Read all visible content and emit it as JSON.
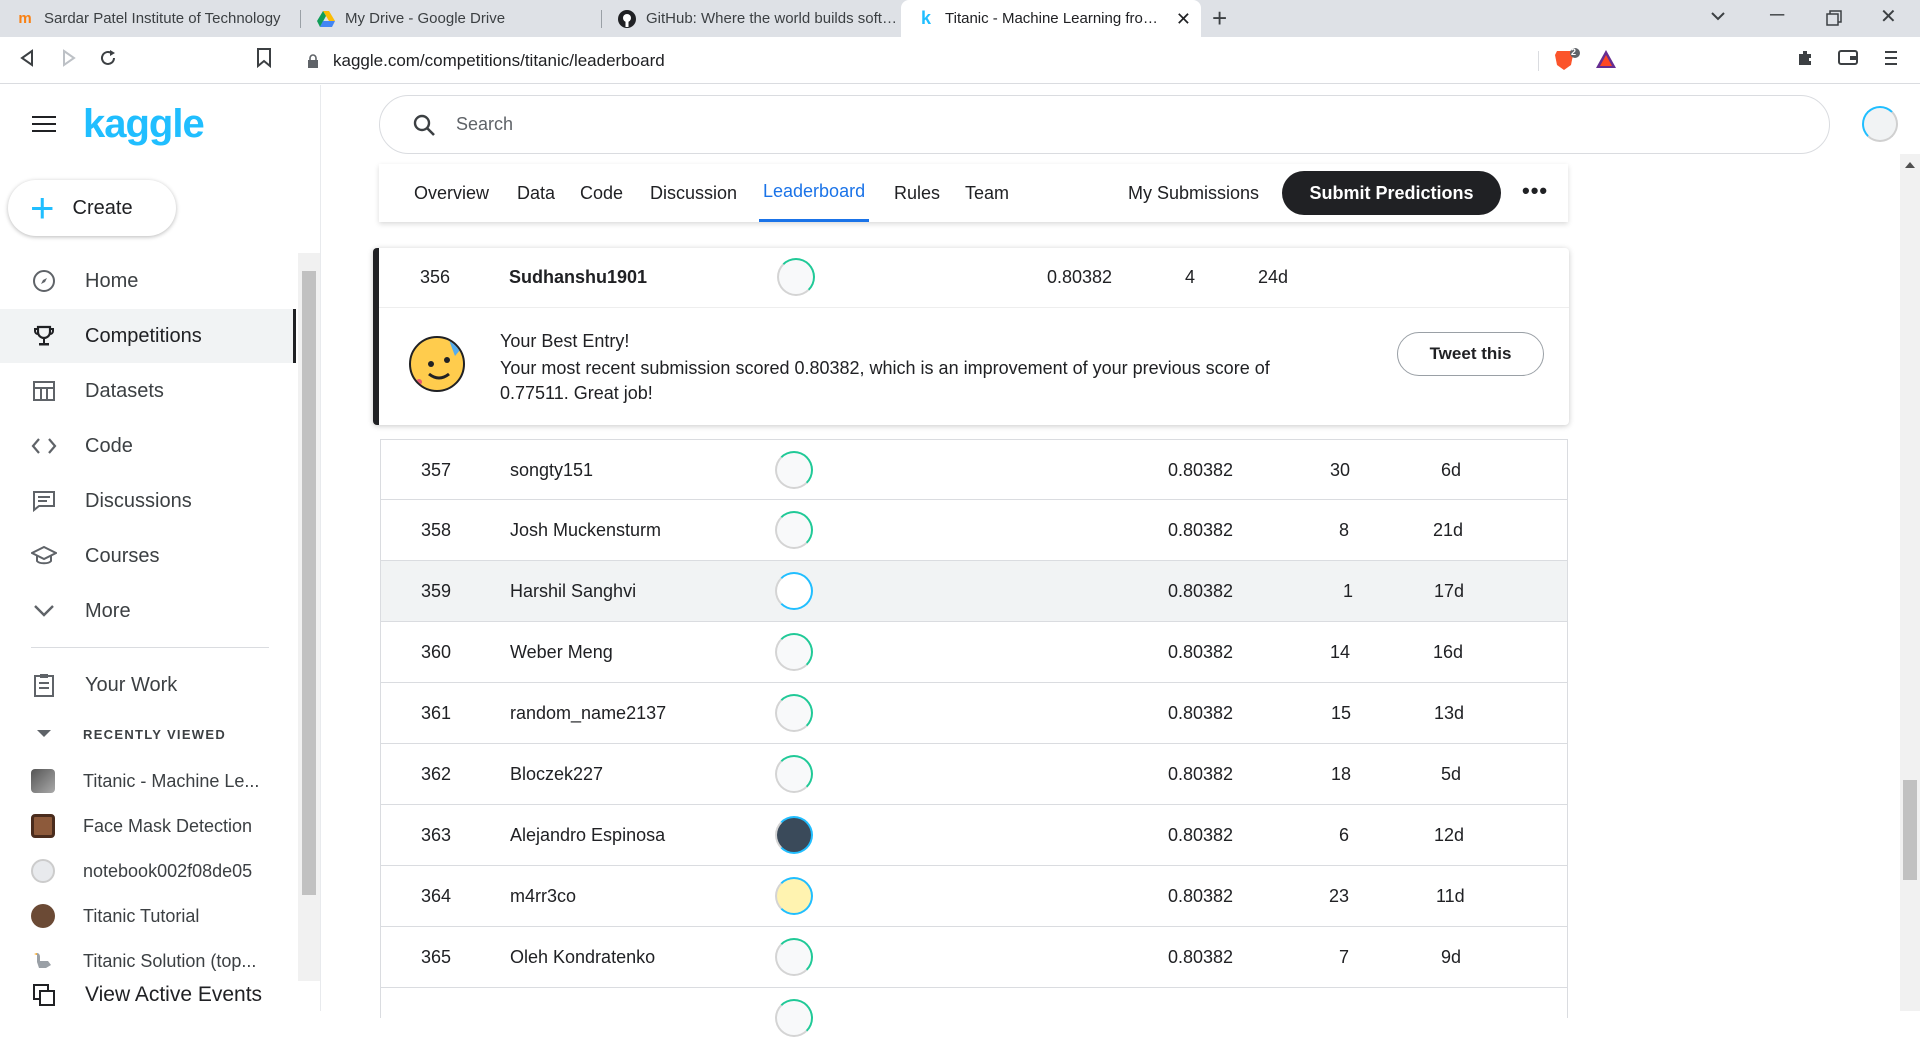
{
  "browser": {
    "tabs": [
      {
        "title": "Sardar Patel Institute of Technology",
        "icon": "moodle-icon"
      },
      {
        "title": "My Drive - Google Drive",
        "icon": "google-drive-icon"
      },
      {
        "title": "GitHub: Where the world builds softw...",
        "icon": "github-icon"
      },
      {
        "title": "Titanic - Machine Learning from D",
        "icon": "kaggle-icon"
      }
    ],
    "url": "kaggle.com/competitions/titanic/leaderboard",
    "brave_badge": "2"
  },
  "sidebar": {
    "logo": "kaggle",
    "create_label": "Create",
    "nav": [
      {
        "label": "Home",
        "icon": "compass-icon"
      },
      {
        "label": "Competitions",
        "icon": "trophy-icon"
      },
      {
        "label": "Datasets",
        "icon": "table-icon"
      },
      {
        "label": "Code",
        "icon": "code-icon"
      },
      {
        "label": "Discussions",
        "icon": "comments-icon"
      },
      {
        "label": "Courses",
        "icon": "school-icon"
      },
      {
        "label": "More",
        "icon": "chevron-down-icon"
      }
    ],
    "your_work": "Your Work",
    "recently_viewed_title": "RECENTLY VIEWED",
    "recent": [
      {
        "label": "Titanic - Machine Le..."
      },
      {
        "label": "Face Mask Detection"
      },
      {
        "label": "notebook002f08de05"
      },
      {
        "label": "Titanic Tutorial"
      },
      {
        "label": "Titanic Solution (top..."
      }
    ],
    "active_events": "View Active Events"
  },
  "search": {
    "placeholder": "Search"
  },
  "comp_tabs": {
    "items": [
      "Overview",
      "Data",
      "Code",
      "Discussion",
      "Leaderboard",
      "Rules",
      "Team"
    ],
    "active": "Leaderboard",
    "my_submissions": "My Submissions",
    "submit_label": "Submit Predictions"
  },
  "best_entry": {
    "rank": "356",
    "team": "Sudhanshu1901",
    "score": "0.80382",
    "entries": "4",
    "last": "24d",
    "title": "Your Best Entry!",
    "message": "Your most recent submission scored 0.80382, which is an improvement of your previous score of 0.77511. Great job!",
    "tweet_label": "Tweet this"
  },
  "leaderboard": [
    {
      "rank": "357",
      "team": "songty151",
      "score": "0.80382",
      "entries": "30",
      "last": "6d"
    },
    {
      "rank": "358",
      "team": "Josh Muckensturm",
      "score": "0.80382",
      "entries": "8",
      "last": "21d"
    },
    {
      "rank": "359",
      "team": "Harshil Sanghvi",
      "score": "0.80382",
      "entries": "1",
      "last": "17d"
    },
    {
      "rank": "360",
      "team": "Weber Meng",
      "score": "0.80382",
      "entries": "14",
      "last": "16d"
    },
    {
      "rank": "361",
      "team": "random_name2137",
      "score": "0.80382",
      "entries": "15",
      "last": "13d"
    },
    {
      "rank": "362",
      "team": "Bloczek227",
      "score": "0.80382",
      "entries": "18",
      "last": "5d"
    },
    {
      "rank": "363",
      "team": "Alejandro Espinosa",
      "score": "0.80382",
      "entries": "6",
      "last": "12d"
    },
    {
      "rank": "364",
      "team": "m4rr3co",
      "score": "0.80382",
      "entries": "23",
      "last": "11d"
    },
    {
      "rank": "365",
      "team": "Oleh Kondratenko",
      "score": "0.80382",
      "entries": "7",
      "last": "9d"
    }
  ]
}
